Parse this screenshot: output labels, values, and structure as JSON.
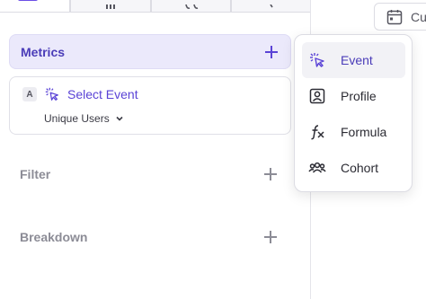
{
  "tabs": [
    {
      "name": "tab-metrics-view",
      "icon": "list-icon",
      "active": true
    },
    {
      "name": "tab-chart-view",
      "icon": "chart-icon",
      "active": false
    },
    {
      "name": "tab-flows-view",
      "icon": "flows-icon",
      "active": false
    },
    {
      "name": "tab-other-view",
      "icon": "other-icon",
      "active": false
    }
  ],
  "date_control": {
    "icon": "calendar-icon",
    "label": "Cu"
  },
  "metrics": {
    "title": "Metrics",
    "items": [
      {
        "letter": "A",
        "event_label": "Select Event",
        "aggregation": "Unique Users"
      }
    ]
  },
  "filter": {
    "title": "Filter"
  },
  "breakdown": {
    "title": "Breakdown"
  },
  "menu": {
    "items": [
      {
        "label": "Event",
        "icon": "cursor-click-icon",
        "selected": true
      },
      {
        "label": "Profile",
        "icon": "profile-icon",
        "selected": false
      },
      {
        "label": "Formula",
        "icon": "formula-icon",
        "selected": false
      },
      {
        "label": "Cohort",
        "icon": "cohort-icon",
        "selected": false
      }
    ]
  },
  "colors": {
    "accent": "#5a43d6",
    "accent_bg": "#ebe9fb",
    "muted": "#8c8c96"
  }
}
